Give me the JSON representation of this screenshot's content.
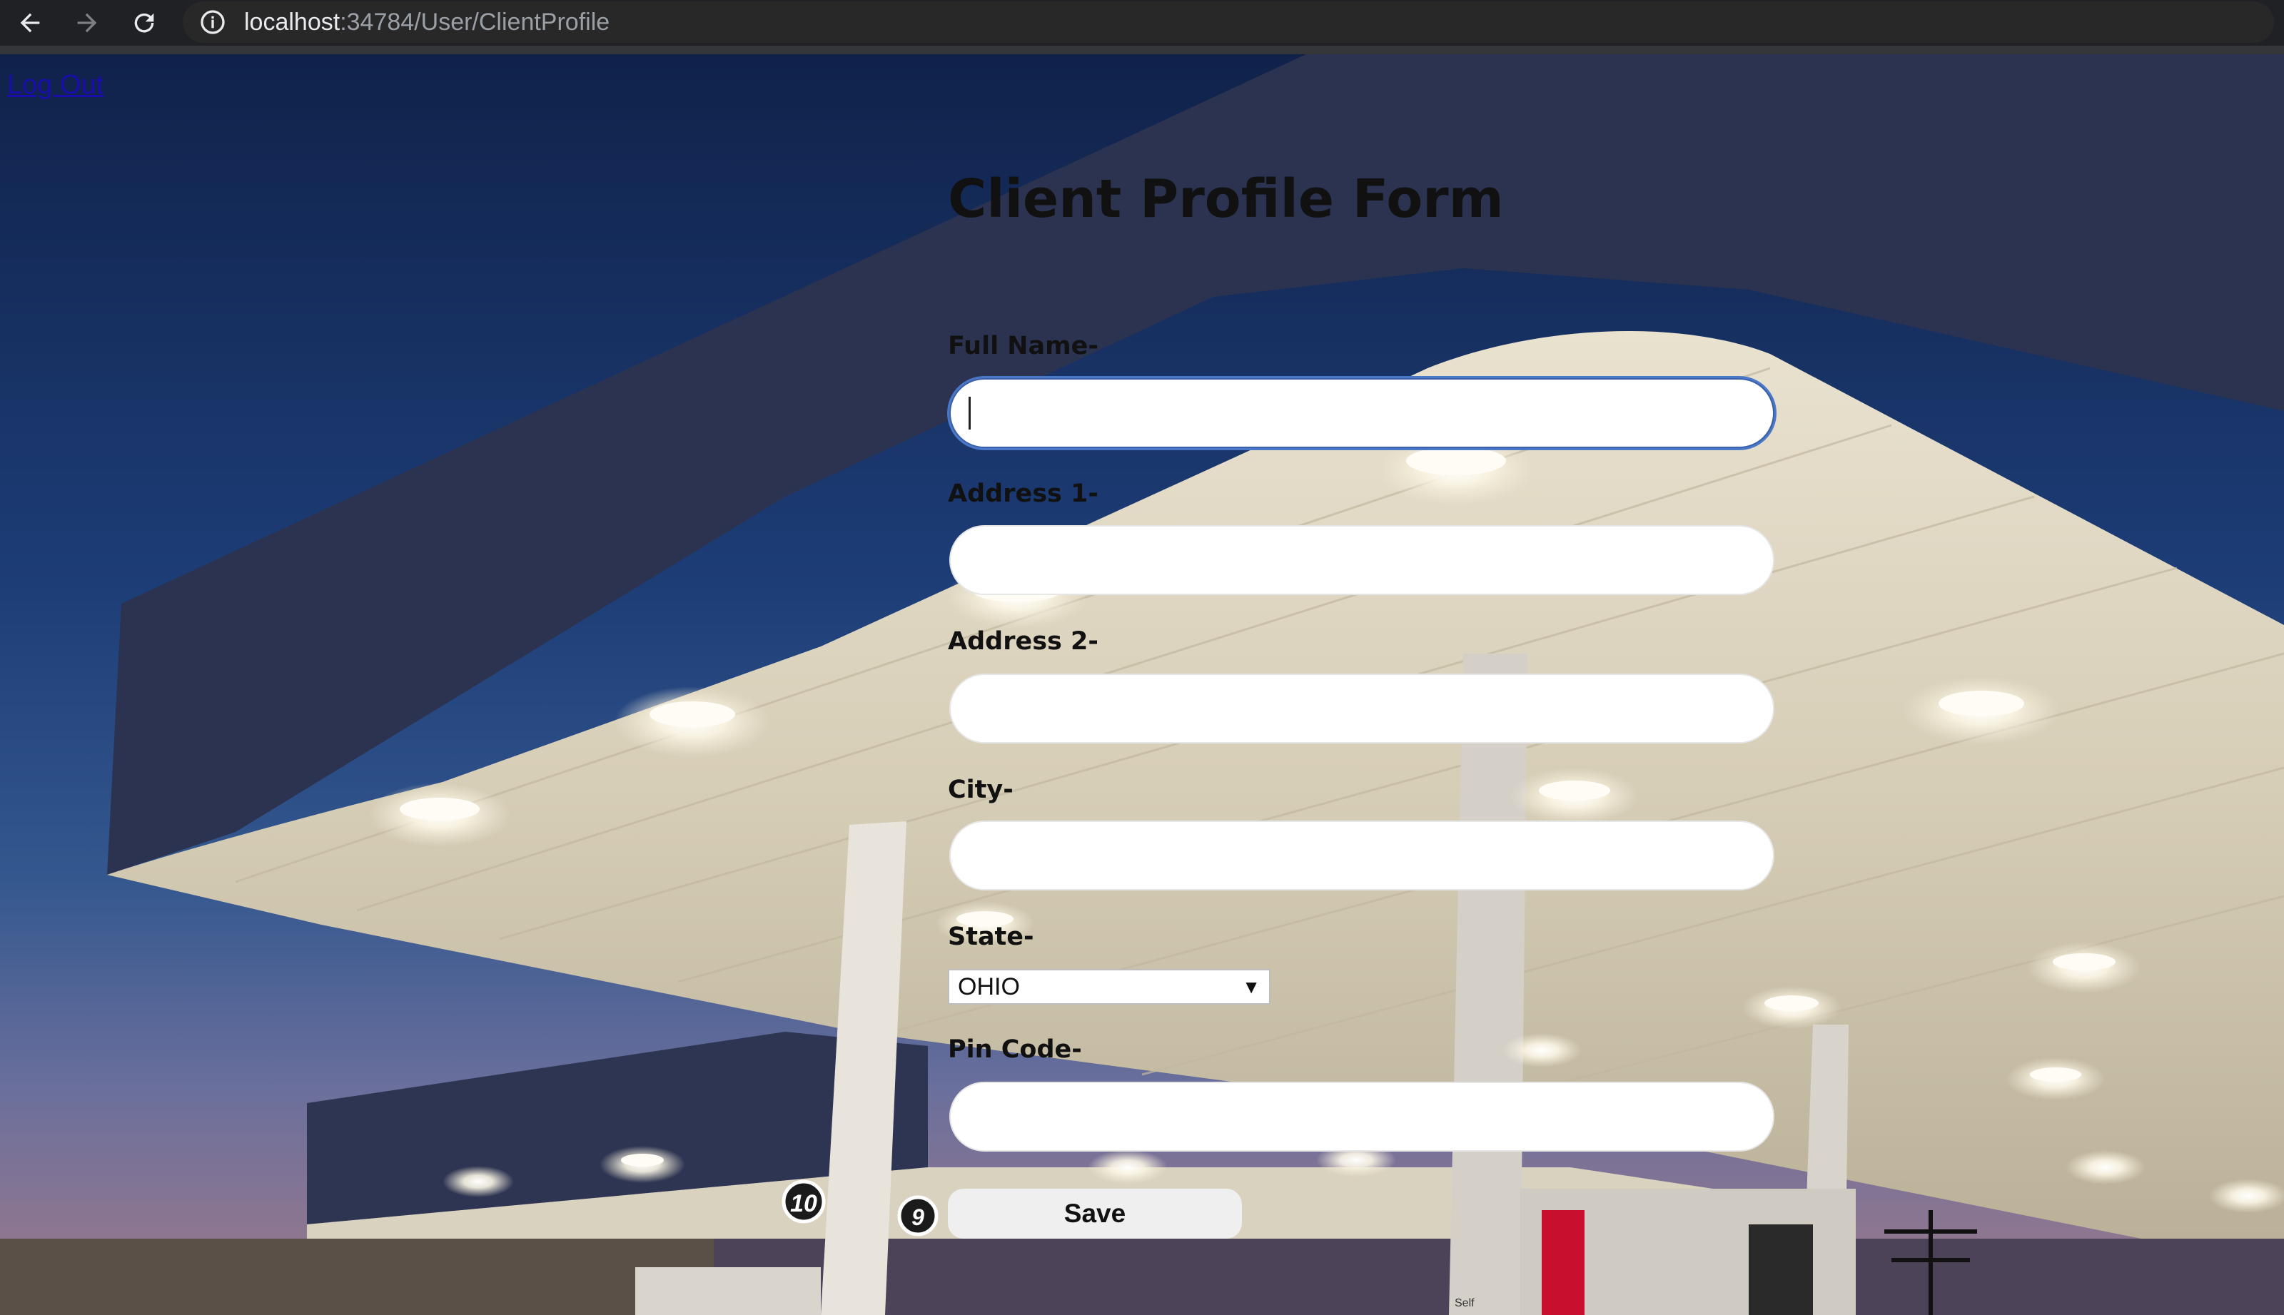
{
  "browser": {
    "url_host": "localhost",
    "url_path": ":34784/User/ClientProfile",
    "icons": [
      "back-arrow-icon",
      "forward-arrow-icon",
      "reload-icon",
      "site-info-icon"
    ]
  },
  "nav": {
    "logout_label": "Log Out"
  },
  "form": {
    "title": "Client Profile Form",
    "full_name": {
      "label": "Full Name-",
      "value": ""
    },
    "address1": {
      "label": "Address 1-",
      "value": ""
    },
    "address2": {
      "label": "Address 2-",
      "value": ""
    },
    "city": {
      "label": "City-",
      "value": ""
    },
    "state": {
      "label": "State-",
      "selected": "OHIO",
      "arrow": "▼"
    },
    "pin_code": {
      "label": "Pin Code-",
      "value": ""
    },
    "save_label": "Save"
  },
  "pump_numbers": [
    "10",
    "9"
  ],
  "pump_sign": "Self",
  "colors": {
    "sky_top": "#10224a",
    "canopy": "#d9d2c0",
    "link": "#1a0dab",
    "focus_ring": "#4a78c8"
  }
}
